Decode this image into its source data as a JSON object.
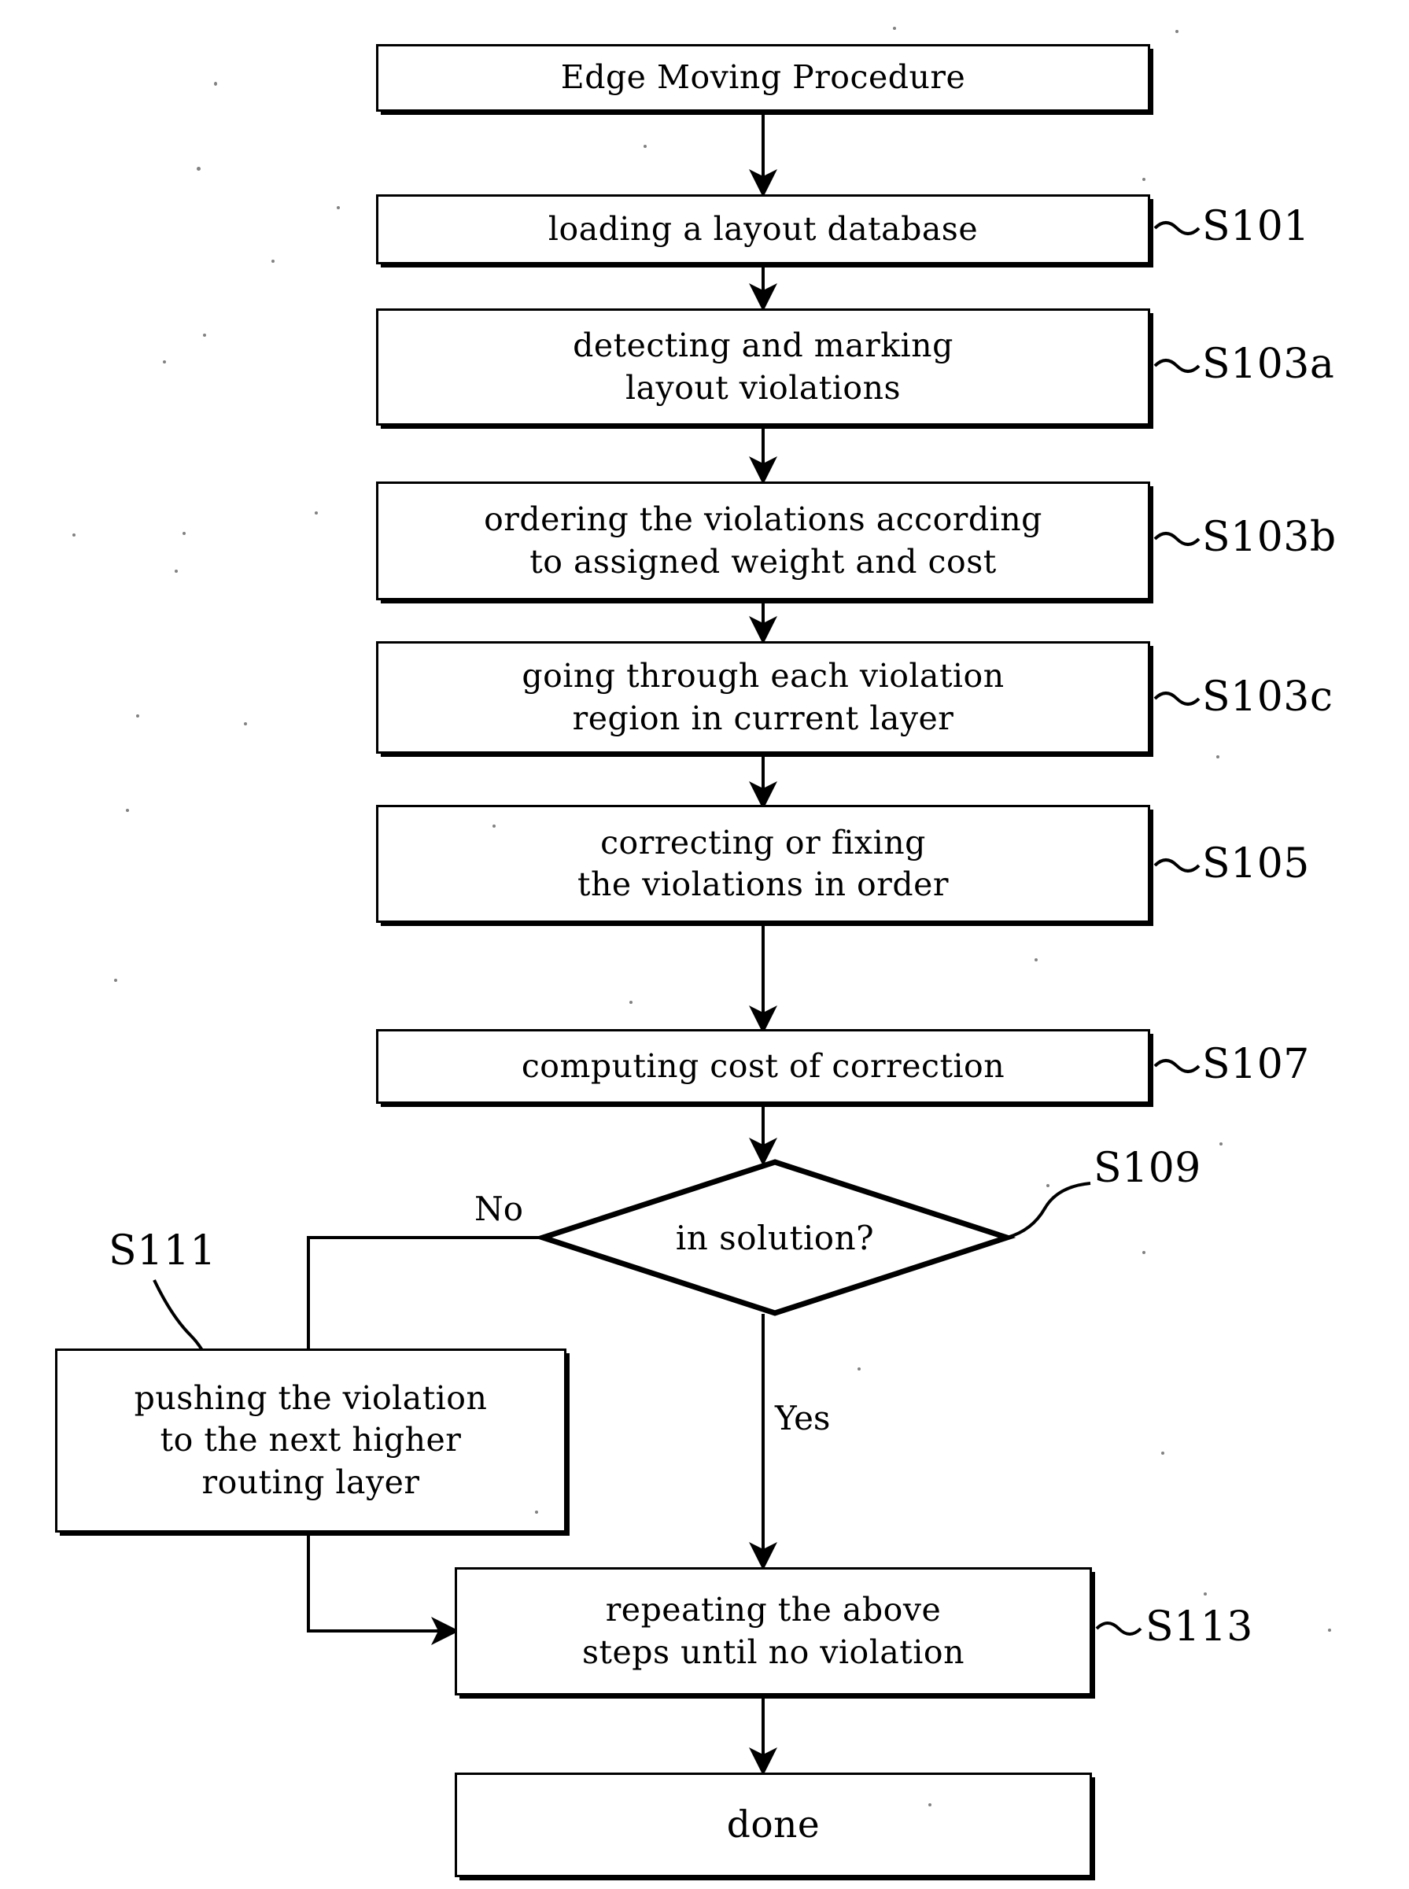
{
  "diagram": {
    "type": "flowchart",
    "title": "Edge Moving Procedure",
    "orientation": "top-to-bottom",
    "nodes": [
      {
        "id": "start",
        "shape": "process",
        "text": "Edge Moving Procedure",
        "tag": ""
      },
      {
        "id": "s101",
        "shape": "process",
        "text": "loading a layout database",
        "tag": "S101"
      },
      {
        "id": "s103a",
        "shape": "process",
        "text": "detecting and marking\nlayout violations",
        "tag": "S103a"
      },
      {
        "id": "s103b",
        "shape": "process",
        "text": "ordering the violations according\nto assigned weight and cost",
        "tag": "S103b"
      },
      {
        "id": "s103c",
        "shape": "process",
        "text": "going through each violation\nregion in current layer",
        "tag": "S103c"
      },
      {
        "id": "s105",
        "shape": "process",
        "text": "correcting or fixing\nthe violations in order",
        "tag": "S105"
      },
      {
        "id": "s107",
        "shape": "process",
        "text": "computing cost of correction",
        "tag": "S107"
      },
      {
        "id": "s109",
        "shape": "decision",
        "text": "in solution?",
        "tag": "S109"
      },
      {
        "id": "s111",
        "shape": "process",
        "text": "pushing the violation\nto the next higher\nrouting layer",
        "tag": "S111"
      },
      {
        "id": "s113",
        "shape": "process",
        "text": "repeating the above\nsteps until no violation",
        "tag": "S113"
      },
      {
        "id": "done",
        "shape": "process",
        "text": "done",
        "tag": ""
      }
    ],
    "edges": [
      {
        "from": "start",
        "to": "s101",
        "label": ""
      },
      {
        "from": "s101",
        "to": "s103a",
        "label": ""
      },
      {
        "from": "s103a",
        "to": "s103b",
        "label": ""
      },
      {
        "from": "s103b",
        "to": "s103c",
        "label": ""
      },
      {
        "from": "s103c",
        "to": "s105",
        "label": ""
      },
      {
        "from": "s105",
        "to": "s107",
        "label": ""
      },
      {
        "from": "s107",
        "to": "s109",
        "label": ""
      },
      {
        "from": "s109",
        "to": "s111",
        "label": "No"
      },
      {
        "from": "s109",
        "to": "s113",
        "label": "Yes"
      },
      {
        "from": "s111",
        "to": "s113",
        "label": ""
      },
      {
        "from": "s113",
        "to": "done",
        "label": ""
      }
    ],
    "edge_labels": {
      "no": "No",
      "yes": "Yes"
    },
    "tags": {
      "s101": "S101",
      "s103a": "S103a",
      "s103b": "S103b",
      "s103c": "S103c",
      "s105": "S105",
      "s107": "S107",
      "s109": "S109",
      "s111": "S111",
      "s113": "S113"
    },
    "node_text": {
      "start": "Edge Moving Procedure",
      "s101": "loading a layout database",
      "s103a": "detecting and marking\nlayout violations",
      "s103b": "ordering the violations according\nto assigned weight and cost",
      "s103c": "going through each violation\nregion in current layer",
      "s105": "correcting or fixing\nthe violations in order",
      "s107": "computing cost of correction",
      "s109": "in solution?",
      "s111": "pushing the violation\nto the next higher\nrouting layer",
      "s113": "repeating the above\nsteps until no violation",
      "done": "done"
    },
    "colors": {
      "stroke": "#000000",
      "fill": "#ffffff",
      "text": "#000000"
    }
  }
}
